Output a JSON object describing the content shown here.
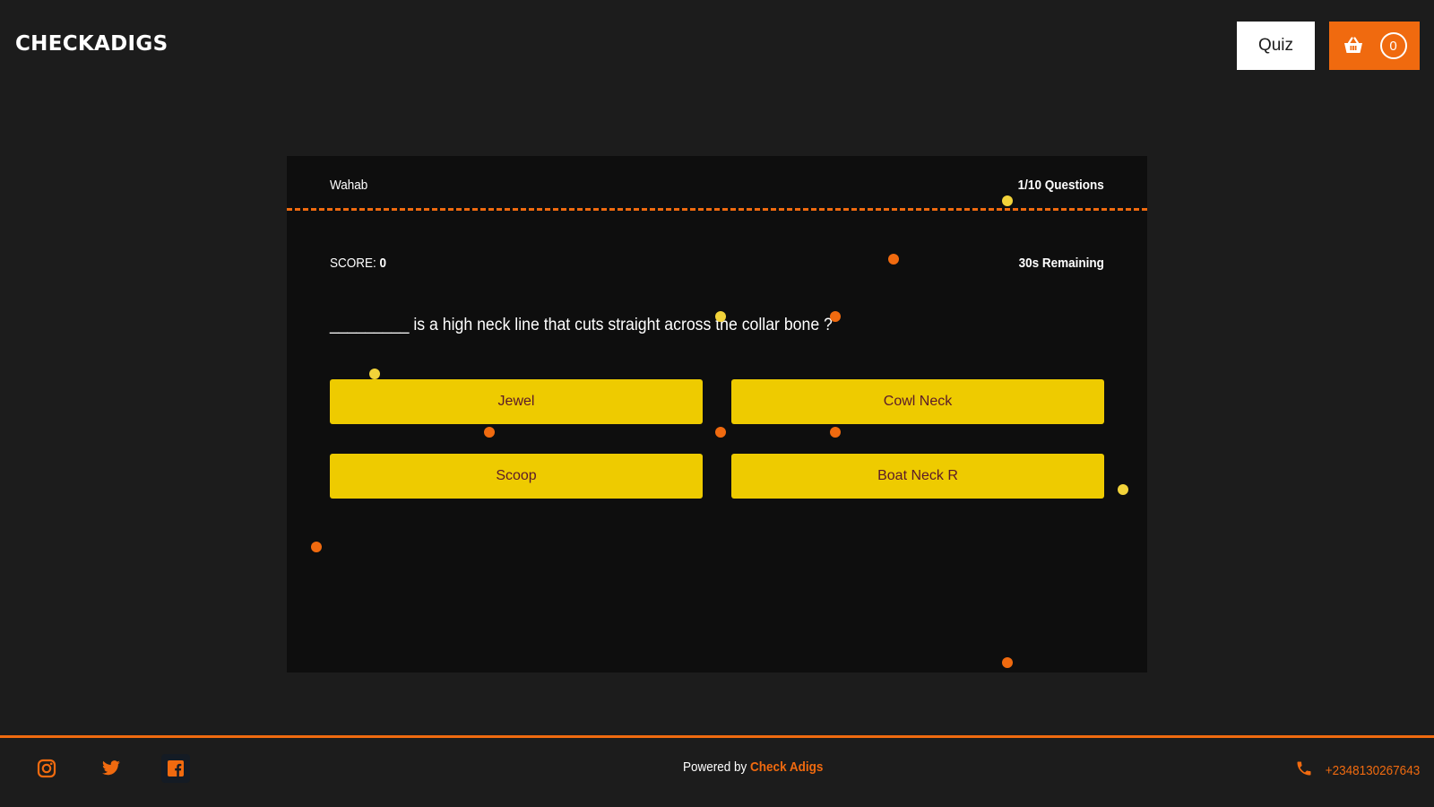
{
  "header": {
    "brand": "CHECKADIGS",
    "quiz_label": "Quiz",
    "cart_count": "0",
    "icons": {
      "cart": "basket-icon"
    }
  },
  "quiz": {
    "player_name": "Wahab",
    "progress": "1/10 Questions",
    "score_label": "SCORE:",
    "score_value": "0",
    "time_remaining": "30s Remaining",
    "question": "_________ is a high neck line that cuts straight across the collar bone ?",
    "options": [
      "Jewel",
      "Cowl Neck",
      "Scoop",
      "Boat Neck R"
    ]
  },
  "footer": {
    "powered_prefix": "Powered by ",
    "powered_brand": "Check Adigs",
    "phone": "+2348130267643",
    "social_icons": [
      "instagram-icon",
      "twitter-icon",
      "facebook-icon"
    ]
  },
  "colors": {
    "accent": "#f06a0f",
    "option_bg": "#eecb00",
    "option_text": "#5a1a2a",
    "page_bg": "#1c1c1c",
    "card_bg": "#0e0e0e",
    "confetti_yellow": "#f2d33a"
  }
}
